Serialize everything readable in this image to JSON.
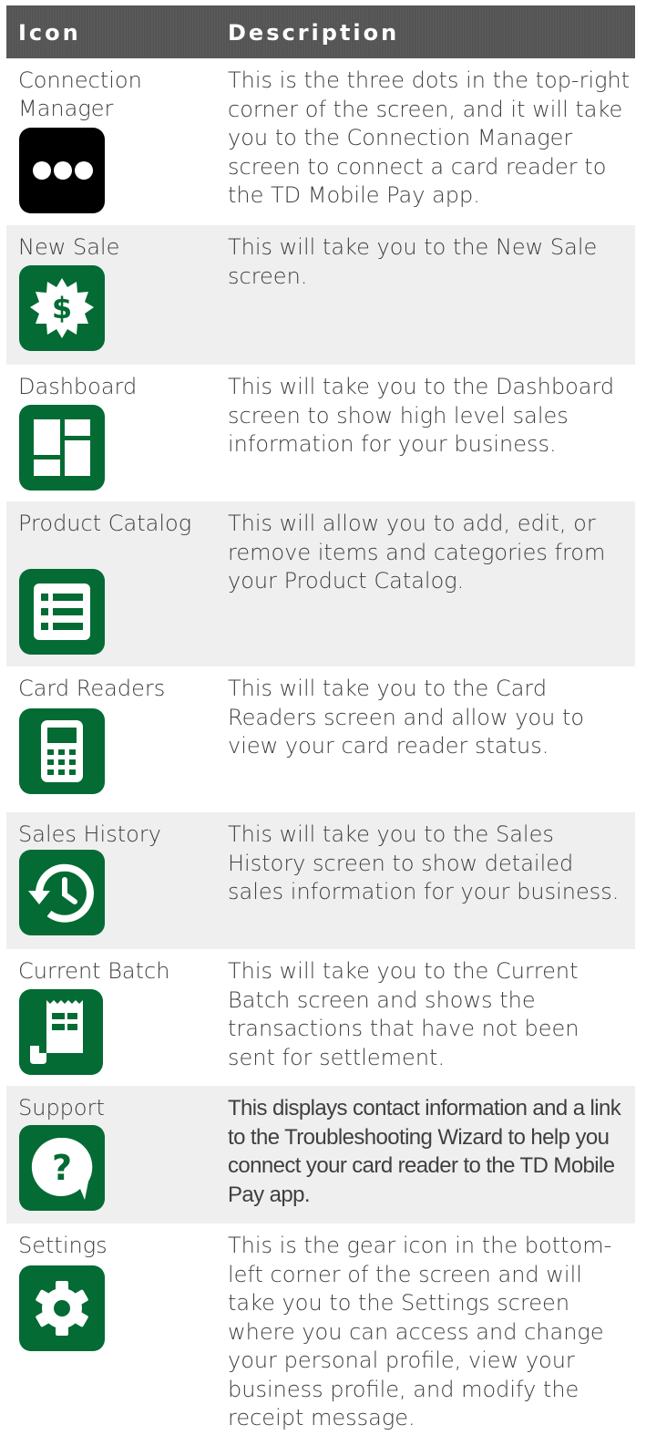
{
  "header": {
    "icon_label": "Icon",
    "description_label": "Description"
  },
  "colors": {
    "header_bg": "#555555",
    "icon_green": "#036b33",
    "icon_black": "#000000",
    "row_alt": "#efefef",
    "text": "#3f3f3f"
  },
  "rows": [
    {
      "name": "Connection Manager",
      "icon": "three-dots-icon",
      "description": "This is the three dots in the top-right corner of the screen, and it will take you to the Connection Manager screen to connect a card reader to the TD Mobile Pay app."
    },
    {
      "name": "New Sale",
      "icon": "dollar-badge-icon",
      "description": "This will take you to the New Sale screen."
    },
    {
      "name": "Dashboard",
      "icon": "dashboard-tiles-icon",
      "description": "This will take you to the Dashboard screen to show high level sales information for your business."
    },
    {
      "name": "Product Catalog",
      "icon": "list-icon",
      "description": "This will allow you to add, edit, or remove items and categories from your Product Catalog."
    },
    {
      "name": "Card Readers",
      "icon": "card-reader-icon",
      "description": "This will take you to the Card Readers screen and allow you to view your card reader status."
    },
    {
      "name": "Sales History",
      "icon": "history-clock-icon",
      "description": "This will take you to the Sales History screen to show detailed sales information for your business."
    },
    {
      "name": "Current Batch",
      "icon": "receipt-icon",
      "description": "This will take you to the Current Batch screen and shows the transactions that have not been sent for settlement."
    },
    {
      "name": "Support",
      "icon": "help-question-icon",
      "description": "This displays contact information and a link to the Troubleshooting Wizard to help you connect your card reader to the TD Mobile Pay app."
    },
    {
      "name": "Settings",
      "icon": "gear-icon",
      "description": "This is the gear icon in the bottom-left corner of the screen and will take you to the Settings screen where you can access and change your personal profile, view your business profile, and modify the receipt message."
    }
  ]
}
